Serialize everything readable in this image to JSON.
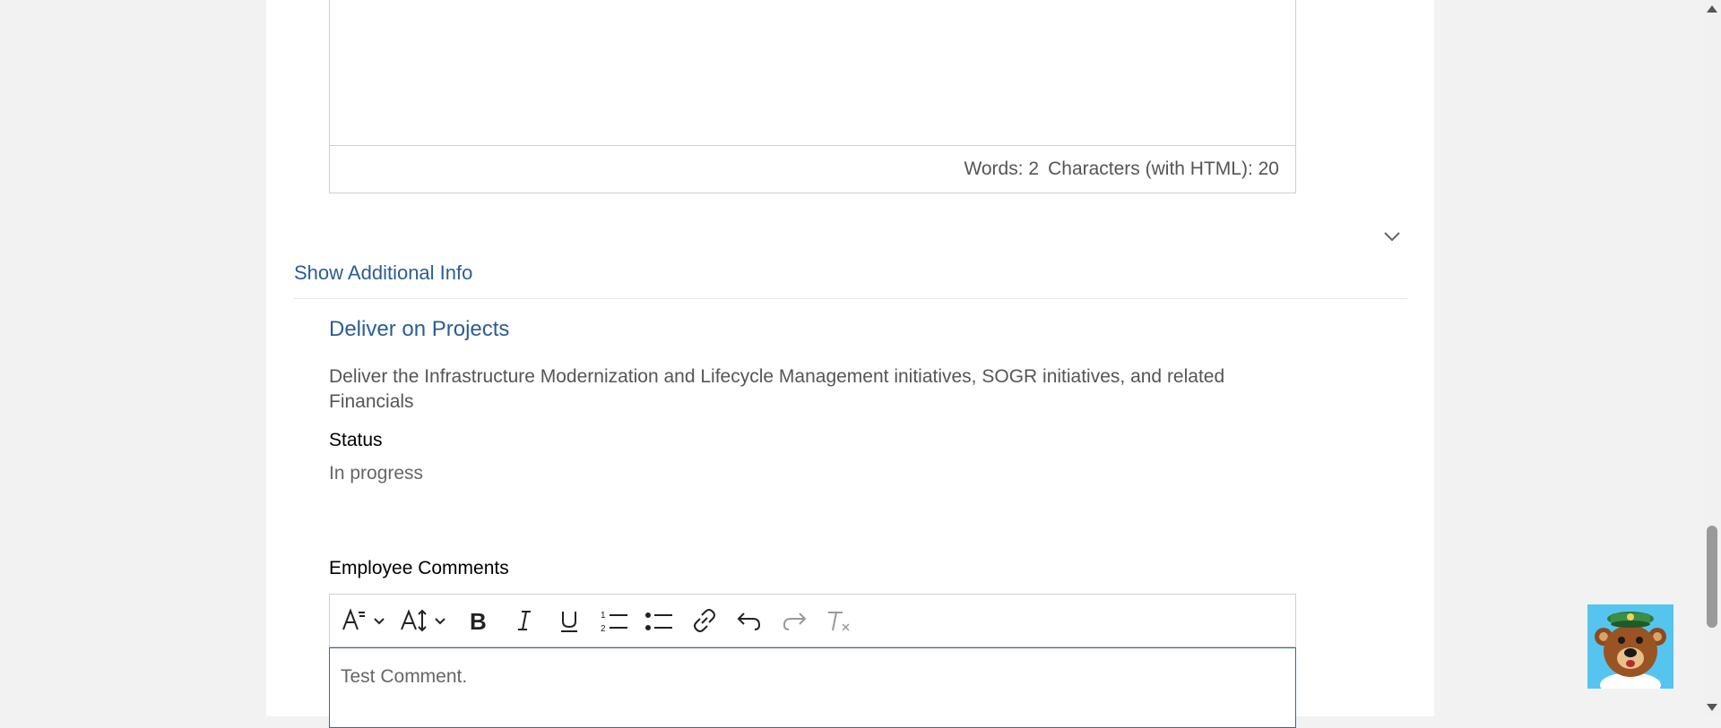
{
  "editor_top": {
    "words": "Words: 2",
    "characters": "Characters (with HTML): 20"
  },
  "additional_info": {
    "toggle_label": "Show Additional Info"
  },
  "goal": {
    "title": "Deliver on Projects",
    "description": "Deliver the Infrastructure Modernization and Lifecycle Management initiatives, SOGR initiatives, and related Financials",
    "status_label": "Status",
    "status_value": "In progress"
  },
  "comments": {
    "label": "Employee Comments",
    "content": "Test Comment.",
    "toolbar": [
      "font-style-icon",
      "font-size-icon",
      "bold-icon",
      "italic-icon",
      "underline-icon",
      "numbered-list-icon",
      "bulleted-list-icon",
      "link-icon",
      "undo-icon",
      "redo-icon",
      "clear-formatting-icon"
    ]
  },
  "colors": {
    "link_blue": "#2b5e93",
    "focus_border": "#2b6cb0",
    "mascot_bg": "#55c5f0"
  }
}
